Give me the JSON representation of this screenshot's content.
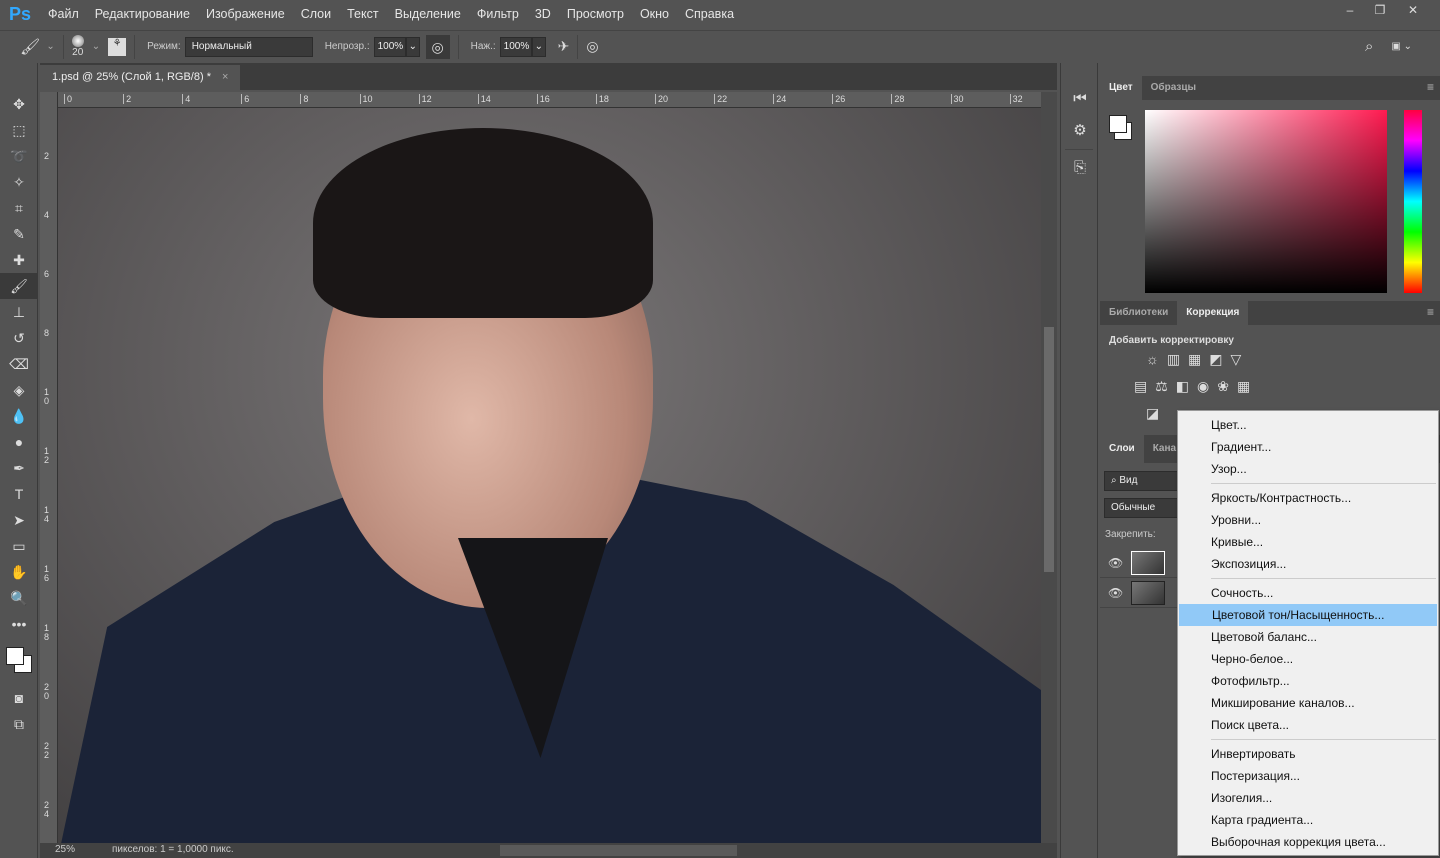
{
  "app": {
    "logo": "Ps",
    "menu": [
      "Файл",
      "Редактирование",
      "Изображение",
      "Слои",
      "Текст",
      "Выделение",
      "Фильтр",
      "3D",
      "Просмотр",
      "Окно",
      "Справка"
    ],
    "window_controls": [
      "minimize-icon",
      "restore-icon",
      "close-icon"
    ]
  },
  "options": {
    "brush_size": "20",
    "mode_label": "Режим:",
    "mode_value": "Нормальный",
    "opacity_label": "Непрозр.:",
    "opacity_value": "100%",
    "flow_label": "Наж.:",
    "flow_value": "100%"
  },
  "document": {
    "tab_title": "1.psd @ 25% (Слой 1, RGB/8) *",
    "close": "×",
    "ruler_top": [
      "0",
      "2",
      "4",
      "6",
      "8",
      "10",
      "12",
      "14",
      "16",
      "18",
      "20",
      "22",
      "24",
      "26",
      "28",
      "30",
      "32"
    ],
    "ruler_left": [
      "2",
      "4",
      "6",
      "8",
      "10",
      "12",
      "14",
      "16",
      "18",
      "20",
      "22",
      "24"
    ]
  },
  "status": {
    "zoom": "25%",
    "info": "пикселов: 1 = 1,0000 пикс."
  },
  "color_panel": {
    "tabs": [
      "Цвет",
      "Образцы"
    ],
    "foreground": "#ffffff",
    "background": "#ffffff",
    "hue_color": "#ff1a50"
  },
  "adjust_panel": {
    "tabs": [
      "Библиотеки",
      "Коррекция"
    ],
    "title": "Добавить корректировку"
  },
  "layers_panel": {
    "tabs": [
      "Слои",
      "Кана"
    ],
    "search": "Вид",
    "blend": "Обычные",
    "lock_label": "Закрепить:"
  },
  "dropdown": {
    "groups": [
      [
        "Цвет...",
        "Градиент...",
        "Узор..."
      ],
      [
        "Яркость/Контрастность...",
        "Уровни...",
        "Кривые...",
        "Экспозиция..."
      ],
      [
        "Сочность...",
        "Цветовой тон/Насыщенность...",
        "Цветовой баланс...",
        "Черно-белое...",
        "Фотофильтр...",
        "Микширование каналов...",
        "Поиск цвета..."
      ],
      [
        "Инвертировать",
        "Постеризация...",
        "Изогелия...",
        "Карта градиента...",
        "Выборочная коррекция цвета..."
      ]
    ],
    "highlighted": "Цветовой тон/Насыщенность..."
  }
}
